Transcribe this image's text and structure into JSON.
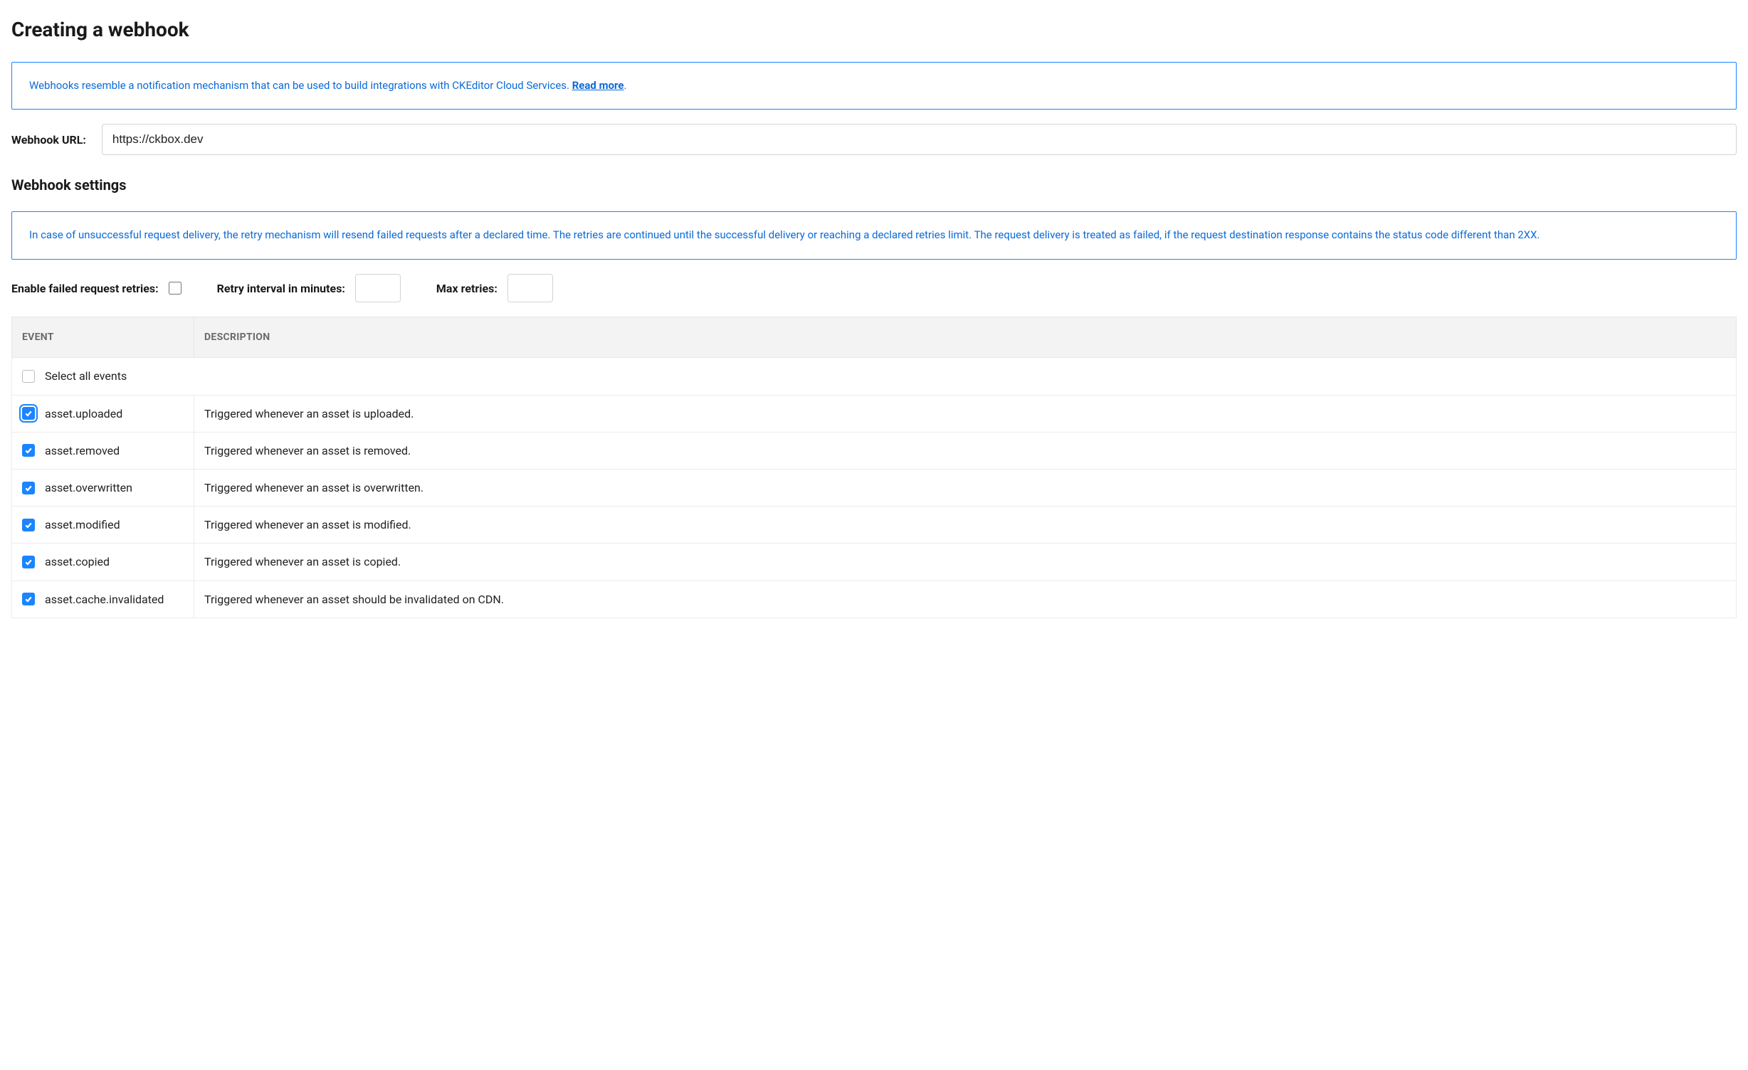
{
  "title": "Creating a webhook",
  "intro": {
    "text": "Webhooks resemble a notification mechanism that can be used to build integrations with CKEditor Cloud Services. ",
    "link": "Read more",
    "suffix": "."
  },
  "url": {
    "label": "Webhook URL:",
    "value": "https://ckbox.dev"
  },
  "settings": {
    "title": "Webhook settings",
    "info": "In case of unsuccessful request delivery, the retry mechanism will resend failed requests after a declared time. The retries are continued until the successful delivery or reaching a declared retries limit. The request delivery is treated as failed, if the request destination response contains the status code different than 2XX.",
    "enable_retries_label": "Enable failed request retries:",
    "enable_retries_checked": false,
    "retry_interval_label": "Retry interval in minutes:",
    "retry_interval_value": "",
    "max_retries_label": "Max retries:",
    "max_retries_value": ""
  },
  "table": {
    "header_event": "EVENT",
    "header_desc": "DESCRIPTION",
    "select_all_label": "Select all events",
    "select_all_checked": false,
    "rows": [
      {
        "checked": true,
        "focus": true,
        "name": "asset.uploaded",
        "desc": "Triggered whenever an asset is uploaded."
      },
      {
        "checked": true,
        "focus": false,
        "name": "asset.removed",
        "desc": "Triggered whenever an asset is removed."
      },
      {
        "checked": true,
        "focus": false,
        "name": "asset.overwritten",
        "desc": "Triggered whenever an asset is overwritten."
      },
      {
        "checked": true,
        "focus": false,
        "name": "asset.modified",
        "desc": "Triggered whenever an asset is modified."
      },
      {
        "checked": true,
        "focus": false,
        "name": "asset.copied",
        "desc": "Triggered whenever an asset is copied."
      },
      {
        "checked": true,
        "focus": false,
        "name": "asset.cache.invalidated",
        "desc": "Triggered whenever an asset should be invalidated on CDN."
      }
    ]
  }
}
